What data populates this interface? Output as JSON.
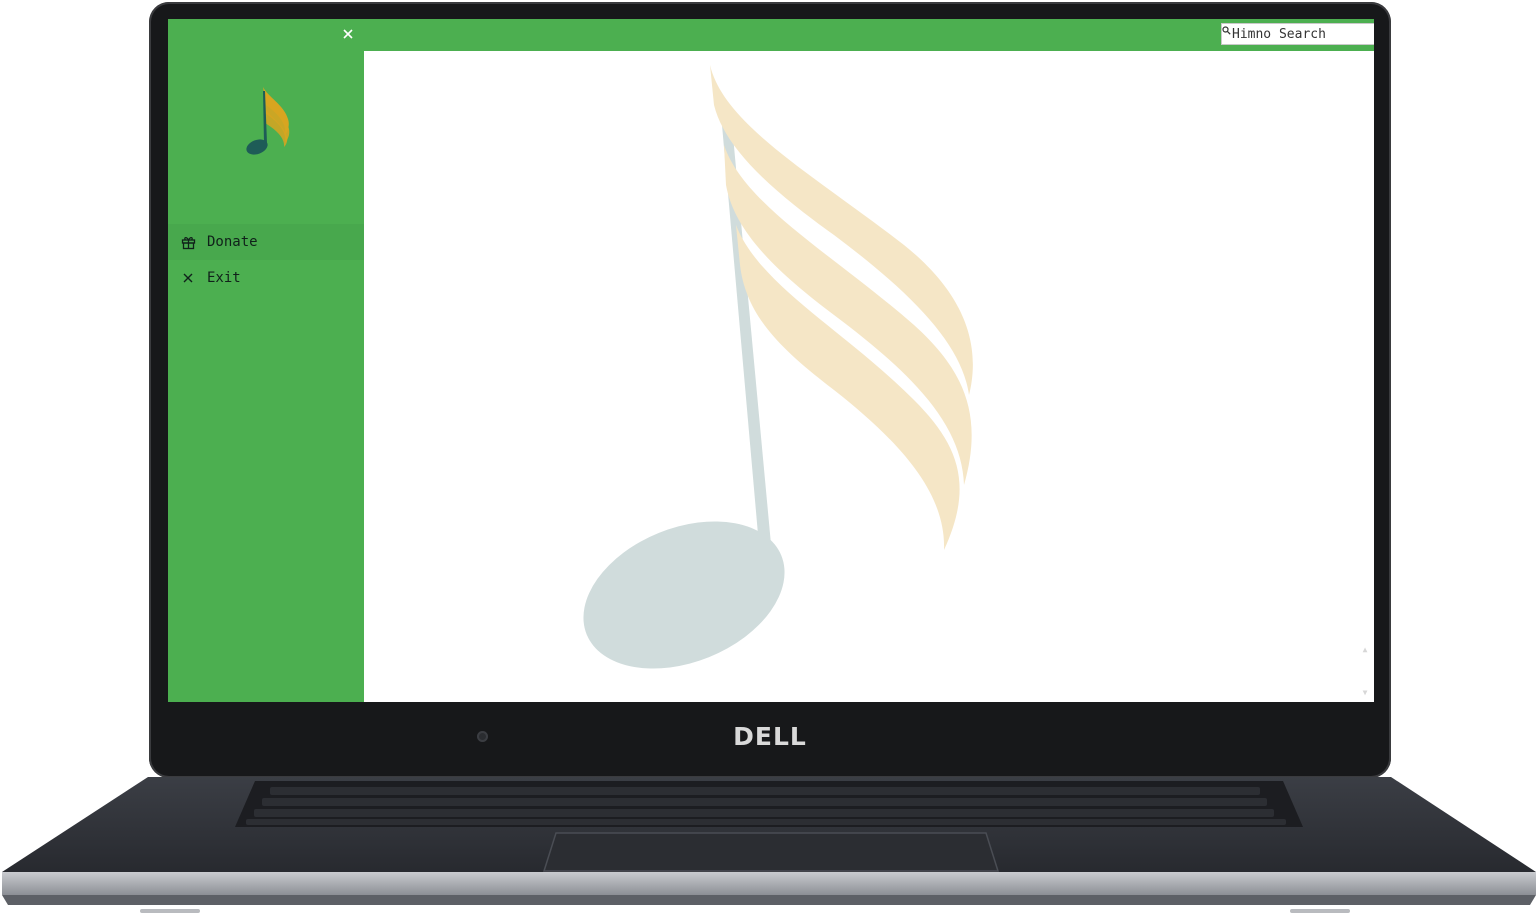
{
  "device": {
    "brand": "DELL"
  },
  "sidebar": {
    "items": [
      {
        "label": "Donate",
        "icon": "gift-icon",
        "active": true
      },
      {
        "label": "Exit",
        "icon": "close-icon",
        "active": false
      }
    ]
  },
  "search": {
    "placeholder": "Himno Search",
    "value": ""
  },
  "window_controls": [
    "edit-icon",
    "minimize-icon",
    "close-icon"
  ],
  "colors": {
    "accent": "#4caf50",
    "logo_note": "#1e5c57",
    "logo_flags": "#d8a520",
    "watermark_note": "#d0dcdc",
    "watermark_flags": "#f5e6c6"
  }
}
